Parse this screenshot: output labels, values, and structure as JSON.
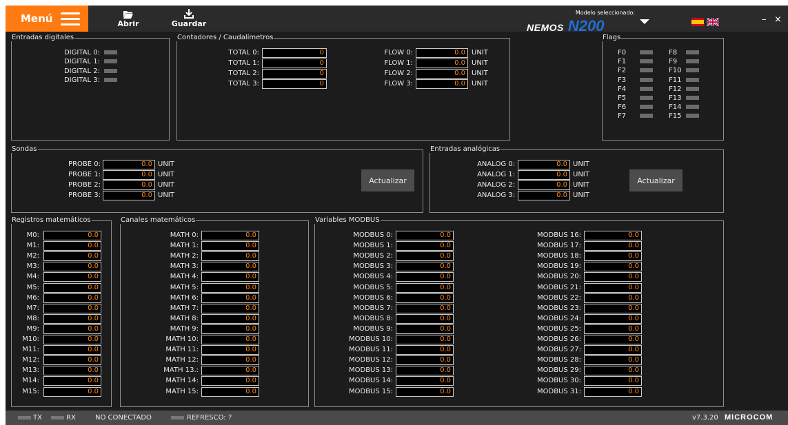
{
  "toolbar": {
    "menu": "Menú",
    "open": "Abrir",
    "save": "Guardar",
    "model_label": "Modelo seleccionado:",
    "logo_a": "NEMOS",
    "logo_b": "N200",
    "minimize": "–",
    "close": "×"
  },
  "colors": {
    "accent": "#ff7b12",
    "value_text": "#ff8a1c",
    "logo_blue": "#1f6fd6"
  },
  "icons": {
    "menu": "hamburger-icon",
    "open": "folder-open-icon",
    "save": "download-icon",
    "dropdown": "caret-down-icon",
    "lang_es": "spain-flag-icon",
    "lang_en": "uk-flag-icon"
  },
  "digital": {
    "title": "Entradas digitales",
    "labels": [
      "DIGITAL 0:",
      "DIGITAL 1:",
      "DIGITAL 2:",
      "DIGITAL 3:"
    ]
  },
  "counters": {
    "title": "Contadores / Caudalímetros",
    "totals": [
      {
        "label": "TOTAL 0:",
        "value": "0"
      },
      {
        "label": "TOTAL 1:",
        "value": "0"
      },
      {
        "label": "TOTAL 2:",
        "value": "0"
      },
      {
        "label": "TOTAL 3:",
        "value": "0"
      }
    ],
    "flows": [
      {
        "label": "FLOW 0:",
        "value": "0.0",
        "unit": "UNIT"
      },
      {
        "label": "FLOW 1:",
        "value": "0.0",
        "unit": "UNIT"
      },
      {
        "label": "FLOW 2:",
        "value": "0.0",
        "unit": "UNIT"
      },
      {
        "label": "FLOW 3:",
        "value": "0.0",
        "unit": "UNIT"
      }
    ]
  },
  "flags": {
    "title": "Flags",
    "left": [
      "F0",
      "F1",
      "F2",
      "F3",
      "F4",
      "F5",
      "F6",
      "F7"
    ],
    "right": [
      "F8",
      "F9",
      "F10",
      "F11",
      "F12",
      "F13",
      "F14",
      "F15"
    ]
  },
  "probes": {
    "title": "Sondas",
    "button": "Actualizar",
    "rows": [
      {
        "label": "PROBE 0:",
        "value": "0.0",
        "unit": "UNIT"
      },
      {
        "label": "PROBE 1:",
        "value": "0.0",
        "unit": "UNIT"
      },
      {
        "label": "PROBE 2:",
        "value": "0.0",
        "unit": "UNIT"
      },
      {
        "label": "PROBE 3:",
        "value": "0.0",
        "unit": "UNIT"
      }
    ]
  },
  "analog": {
    "title": "Entradas analógicas",
    "button": "Actualizar",
    "rows": [
      {
        "label": "ANALOG 0:",
        "value": "0.0",
        "unit": "UNIT"
      },
      {
        "label": "ANALOG 1:",
        "value": "0.0",
        "unit": "UNIT"
      },
      {
        "label": "ANALOG 2:",
        "value": "0.0",
        "unit": "UNIT"
      },
      {
        "label": "ANALOG 3:",
        "value": "0.0",
        "unit": "UNIT"
      }
    ]
  },
  "mregs": {
    "title": "Registros matemáticos",
    "rows": [
      {
        "label": "M0:",
        "value": "0.0"
      },
      {
        "label": "M1:",
        "value": "0.0"
      },
      {
        "label": "M2:",
        "value": "0.0"
      },
      {
        "label": "M3:",
        "value": "0.0"
      },
      {
        "label": "M4:",
        "value": "0.0"
      },
      {
        "label": "M5:",
        "value": "0.0"
      },
      {
        "label": "M6:",
        "value": "0.0"
      },
      {
        "label": "M7:",
        "value": "0.0"
      },
      {
        "label": "M8:",
        "value": "0.0"
      },
      {
        "label": "M9:",
        "value": "0.0"
      },
      {
        "label": "M10:",
        "value": "0.0"
      },
      {
        "label": "M11:",
        "value": "0.0"
      },
      {
        "label": "M12:",
        "value": "0.0"
      },
      {
        "label": "M13:",
        "value": "0.0"
      },
      {
        "label": "M14:",
        "value": "0.0"
      },
      {
        "label": "M15:",
        "value": "0.0"
      }
    ]
  },
  "mchan": {
    "title": "Canales matemáticos",
    "rows": [
      {
        "label": "MATH 0:",
        "value": "0.0"
      },
      {
        "label": "MATH 1:",
        "value": "0.0"
      },
      {
        "label": "MATH 2:",
        "value": "0.0"
      },
      {
        "label": "MATH 3:",
        "value": "0.0"
      },
      {
        "label": "MATH 4:",
        "value": "0.0"
      },
      {
        "label": "MATH 5:",
        "value": "0.0"
      },
      {
        "label": "MATH 6:",
        "value": "0.0"
      },
      {
        "label": "MATH 7:",
        "value": "0.0"
      },
      {
        "label": "MATH 8:",
        "value": "0.0"
      },
      {
        "label": "MATH 9:",
        "value": "0.0"
      },
      {
        "label": "MATH 10:",
        "value": "0.0"
      },
      {
        "label": "MATH 11:",
        "value": "0.0"
      },
      {
        "label": "MATH 12:",
        "value": "0.0"
      },
      {
        "label": "MATH 13.:",
        "value": "0.0"
      },
      {
        "label": "MATH 14:",
        "value": "0.0"
      },
      {
        "label": "MATH 15:",
        "value": "0.0"
      }
    ]
  },
  "modbus": {
    "title": "Variables MODBUS",
    "left": [
      {
        "label": "MODBUS 0:",
        "value": "0.0"
      },
      {
        "label": "MODBUS 1:",
        "value": "0.0"
      },
      {
        "label": "MODBUS 2:",
        "value": "0.0"
      },
      {
        "label": "MODBUS 3:",
        "value": "0.0"
      },
      {
        "label": "MODBUS 4:",
        "value": "0.0"
      },
      {
        "label": "MODBUS 5:",
        "value": "0.0"
      },
      {
        "label": "MODBUS 6:",
        "value": "0.0"
      },
      {
        "label": "MODBUS 7:",
        "value": "0.0"
      },
      {
        "label": "MODBUS 8:",
        "value": "0.0"
      },
      {
        "label": "MODBUS 9:",
        "value": "0.0"
      },
      {
        "label": "MODBUS 10:",
        "value": "0.0"
      },
      {
        "label": "MODBUS 11:",
        "value": "0.0"
      },
      {
        "label": "MODBUS 12:",
        "value": "0.0"
      },
      {
        "label": "MODBUS 13:",
        "value": "0.0"
      },
      {
        "label": "MODBUS 14:",
        "value": "0.0"
      },
      {
        "label": "MODBUS 15:",
        "value": "0.0"
      }
    ],
    "right": [
      {
        "label": "MODBUS 16:",
        "value": "0.0"
      },
      {
        "label": "MODBUS 17:",
        "value": "0.0"
      },
      {
        "label": "MODBUS 18:",
        "value": "0.0"
      },
      {
        "label": "MODBUS 19:",
        "value": "0.0"
      },
      {
        "label": "MODBUS 20:",
        "value": "0.0"
      },
      {
        "label": "MODBUS 21:",
        "value": "0.0"
      },
      {
        "label": "MODBUS 22:",
        "value": "0.0"
      },
      {
        "label": "MODBUS 23:",
        "value": "0.0"
      },
      {
        "label": "MODBUS 24:",
        "value": "0.0"
      },
      {
        "label": "MODBUS 25:",
        "value": "0.0"
      },
      {
        "label": "MODBUS 26:",
        "value": "0.0"
      },
      {
        "label": "MODBUS 27:",
        "value": "0.0"
      },
      {
        "label": "MODBUS 28:",
        "value": "0.0"
      },
      {
        "label": "MODBUS 29:",
        "value": "0.0"
      },
      {
        "label": "MODBUS 30:",
        "value": "0.0"
      },
      {
        "label": "MODBUS 31:",
        "value": "0.0"
      }
    ]
  },
  "status": {
    "tx": "TX",
    "rx": "RX",
    "connection": "NO CONECTADO",
    "refresh": "REFRESCO: ?",
    "version": "v7.3.20",
    "brand": "MICROCOM"
  }
}
